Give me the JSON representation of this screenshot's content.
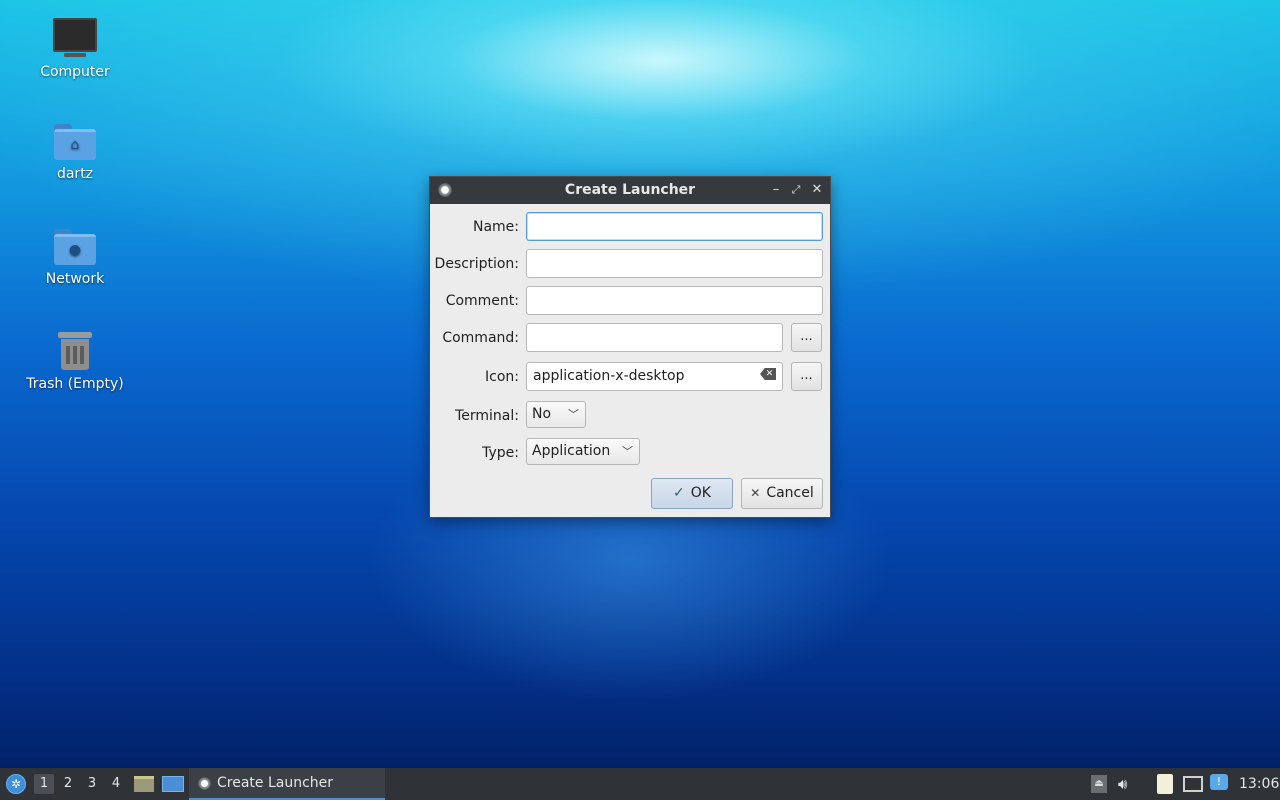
{
  "desktop": {
    "icons": [
      {
        "label": "Computer"
      },
      {
        "label": "dartz"
      },
      {
        "label": "Network"
      },
      {
        "label": "Trash (Empty)"
      }
    ]
  },
  "dialog": {
    "title": "Create Launcher",
    "fields": {
      "name": {
        "label": "Name:",
        "value": "",
        "placeholder": ""
      },
      "description": {
        "label": "Description:",
        "value": ""
      },
      "comment": {
        "label": "Comment:",
        "value": ""
      },
      "command": {
        "label": "Command:",
        "value": ""
      },
      "icon": {
        "label": "Icon:",
        "value": "application-x-desktop"
      },
      "terminal": {
        "label": "Terminal:",
        "selected": "No"
      },
      "type": {
        "label": "Type:",
        "selected": "Application"
      }
    },
    "browse_label": "...",
    "ok_label": "OK",
    "cancel_label": "Cancel"
  },
  "taskbar": {
    "workspaces": [
      "1",
      "2",
      "3",
      "4"
    ],
    "active_workspace": "1",
    "task_title": "Create Launcher",
    "clock": "13:06"
  },
  "colors": {
    "accent": "#4f8fd0",
    "titlebar": "#363a3f",
    "taskbar": "#2f3337"
  }
}
